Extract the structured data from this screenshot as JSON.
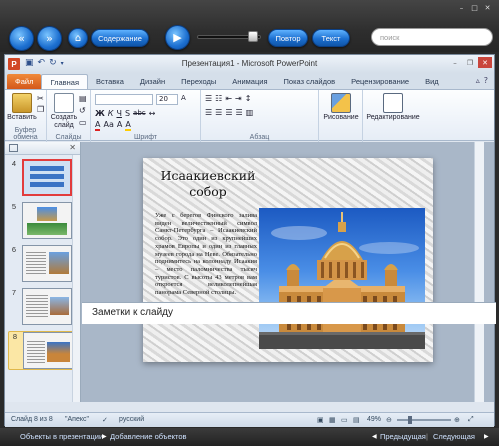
{
  "player": {
    "buttons": {
      "contents": "Содержание",
      "repeat": "Повтор",
      "text": "Текст"
    },
    "search_placeholder": "поиск",
    "icons": [
      "rewind-icon",
      "forward-icon",
      "home-icon",
      "play-icon"
    ]
  },
  "window": {
    "title": "Презентация1 - Microsoft PowerPoint",
    "app_logo": "P"
  },
  "tabs": [
    "Файл",
    "Главная",
    "Вставка",
    "Дизайн",
    "Переходы",
    "Анимация",
    "Показ слайдов",
    "Рецензирование",
    "Вид"
  ],
  "active_tab": "Главная",
  "ribbon": {
    "groups": {
      "clipboard": "Буфер обмена",
      "slides": "Слайды",
      "font": "Шрифт",
      "paragraph": "Абзац"
    },
    "paste_label": "Вставить",
    "new_slide_label": "Создать слайд",
    "drawing_label": "Рисование",
    "editing_label": "Редактирование",
    "font_size": "20",
    "font_buttons": [
      "Ж",
      "К",
      "Ч",
      "S",
      "abc"
    ],
    "font_row2": [
      "A",
      "Aa",
      "A",
      "A"
    ]
  },
  "thumbnails": [
    {
      "num": "4",
      "selected": true
    },
    {
      "num": "5"
    },
    {
      "num": "6"
    },
    {
      "num": "7"
    },
    {
      "num": "8",
      "current": true
    }
  ],
  "slide": {
    "title": "Исаакиевский собор",
    "body": "Уже с берегов Финского залива виден величественный символ Санкт-Петербурга – Исаакиевский собор. Это один из крупнейших храмов Европы и один из главных музеев города на Неве. Обязательно поднимитесь на колоннаду Исаакия – место паломничества тысяч туристов. С высоты 43 метров вам откроется великолепнейшая панорама Северной столицы."
  },
  "notes_placeholder": "Заметки к слайду",
  "status": {
    "slide": "Слайд 8 из 8",
    "theme": "\"Апекс\"",
    "language": "русский",
    "zoom": "49%"
  },
  "bottom": {
    "objects": "Объекты в презентации",
    "adding": "Добавление объектов",
    "previous": "Предыдущая",
    "next": "Следующая"
  }
}
